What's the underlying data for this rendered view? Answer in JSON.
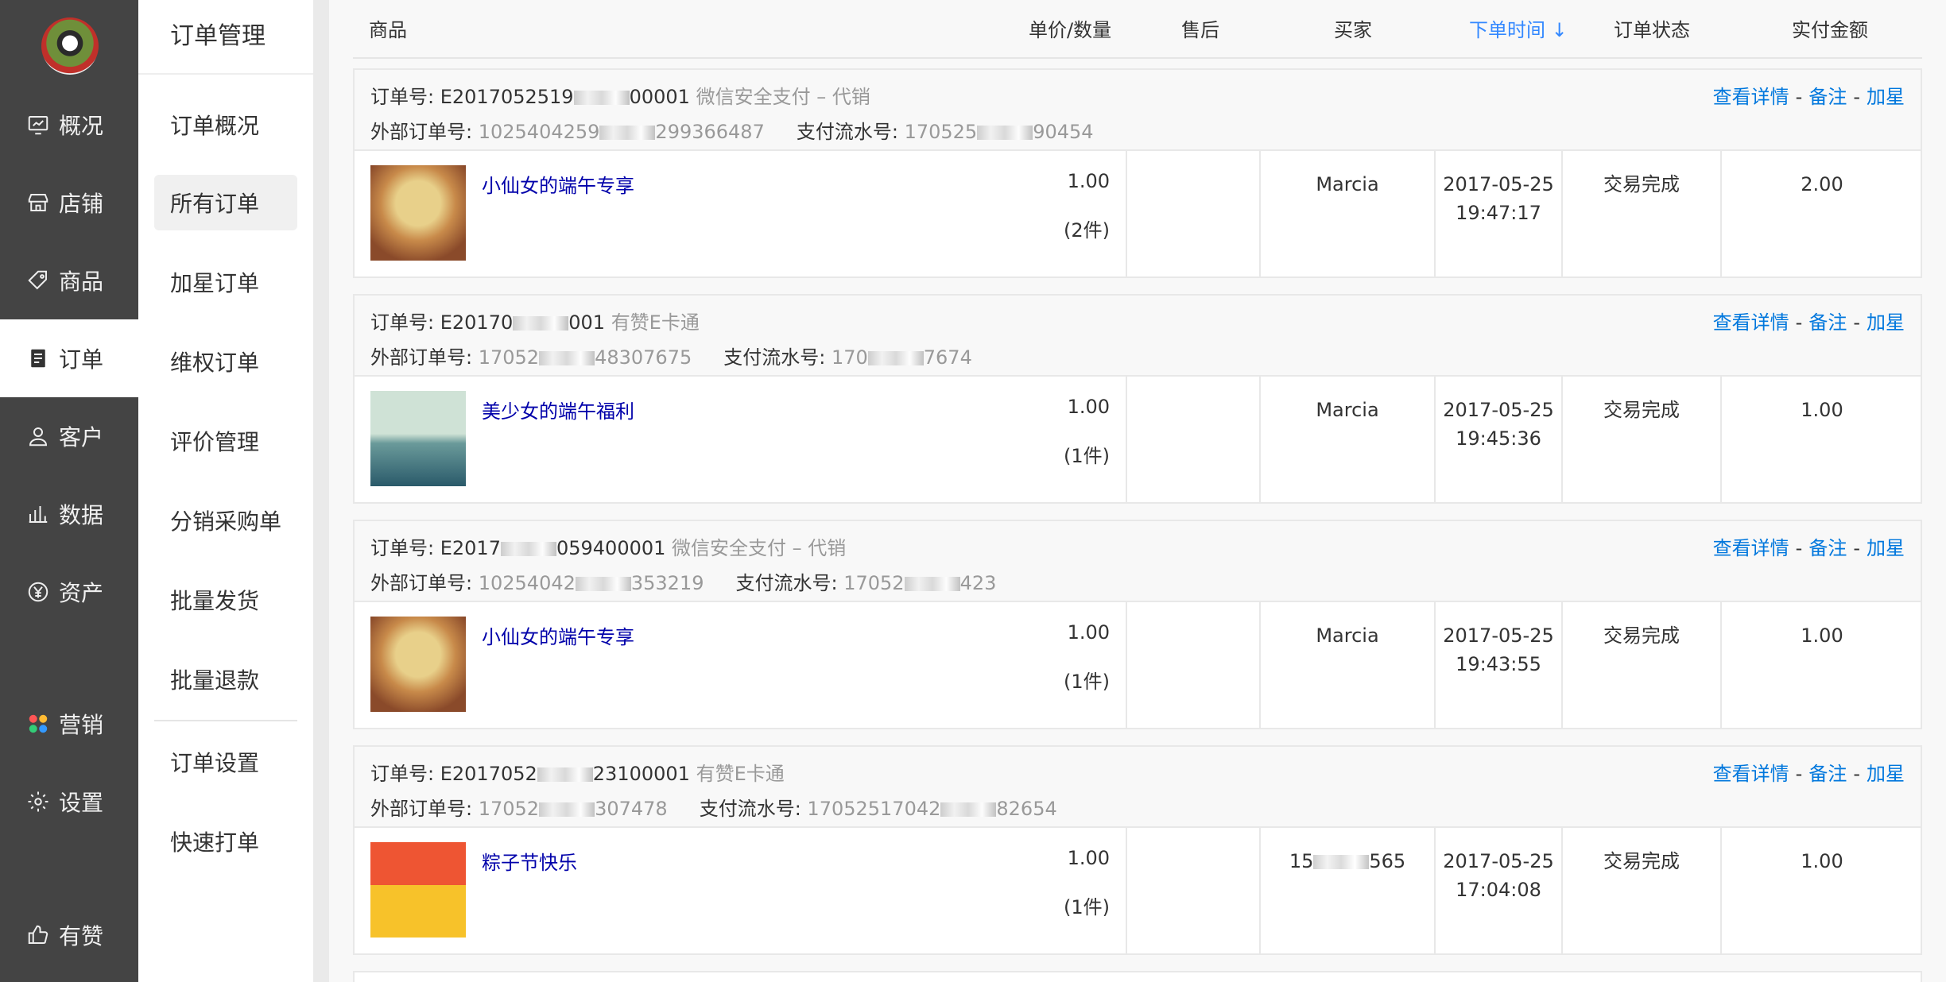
{
  "nav": {
    "items": [
      {
        "label": "概况",
        "icon": "monitor-icon"
      },
      {
        "label": "店铺",
        "icon": "store-icon"
      },
      {
        "label": "商品",
        "icon": "tag-icon"
      },
      {
        "label": "订单",
        "icon": "order-icon"
      },
      {
        "label": "客户",
        "icon": "user-icon"
      },
      {
        "label": "数据",
        "icon": "chart-icon"
      },
      {
        "label": "资产",
        "icon": "yen-icon"
      },
      {
        "label": "营销",
        "icon": "apps-icon"
      },
      {
        "label": "设置",
        "icon": "gear-icon"
      },
      {
        "label": "有赞",
        "icon": "thumb-icon"
      }
    ]
  },
  "subnav": {
    "title": "订单管理",
    "items": [
      "订单概况",
      "所有订单",
      "加星订单",
      "维权订单",
      "评价管理",
      "分销采购单",
      "批量发货",
      "批量退款",
      "订单设置",
      "快速打单"
    ]
  },
  "table": {
    "headers": {
      "product": "商品",
      "price_qty": "单价/数量",
      "after_sale": "售后",
      "buyer": "买家",
      "order_time": "下单时间 ↓",
      "status": "订单状态",
      "paid": "实付金额"
    }
  },
  "actions": {
    "detail": "查看详情",
    "remark": "备注",
    "star": "加星",
    "dash": "-"
  },
  "labels": {
    "order_no": "订单号: ",
    "ext_no": "外部订单号: ",
    "pay_no": "支付流水号: "
  },
  "orders": [
    {
      "order_no_a": "E2017052519",
      "order_no_b": "00001",
      "channel": "微信安全支付 – 代销",
      "ext_a": "1025404259",
      "ext_b": "299366487",
      "pay_a": "170525",
      "pay_b": "90454",
      "product": "小仙女的端午专享",
      "price": "1.00",
      "qty": "(2件)",
      "buyer": "Marcia",
      "date": "2017-05-25",
      "time": "19:47:17",
      "status": "交易完成",
      "paid": "2.00"
    },
    {
      "order_no_a": "E20170",
      "order_no_b": "001",
      "channel": "有赞E卡通",
      "ext_a": "17052",
      "ext_b": "48307675",
      "pay_a": "170",
      "pay_b": "7674",
      "product": "美少女的端午福利",
      "price": "1.00",
      "qty": "(1件)",
      "buyer": "Marcia",
      "date": "2017-05-25",
      "time": "19:45:36",
      "status": "交易完成",
      "paid": "1.00"
    },
    {
      "order_no_a": "E2017",
      "order_no_b": "059400001",
      "channel": "微信安全支付 – 代销",
      "ext_a": "10254042",
      "ext_b": "353219",
      "pay_a": "17052",
      "pay_b": "423",
      "product": "小仙女的端午专享",
      "price": "1.00",
      "qty": "(1件)",
      "buyer": "Marcia",
      "date": "2017-05-25",
      "time": "19:43:55",
      "status": "交易完成",
      "paid": "1.00"
    },
    {
      "order_no_a": "E2017052",
      "order_no_b": "23100001",
      "channel": "有赞E卡通",
      "ext_a": "17052",
      "ext_b": "307478",
      "pay_a": "17052517042",
      "pay_b": "82654",
      "product": "粽子节快乐",
      "price": "1.00",
      "qty": "(1件)",
      "buyer_a": "15",
      "buyer_b": "565",
      "date": "2017-05-25",
      "time": "17:04:08",
      "status": "交易完成",
      "paid": "1.00"
    }
  ],
  "colors": {
    "sidebar": "#444444",
    "link": "#0000aa",
    "sort": "#3388ff"
  }
}
